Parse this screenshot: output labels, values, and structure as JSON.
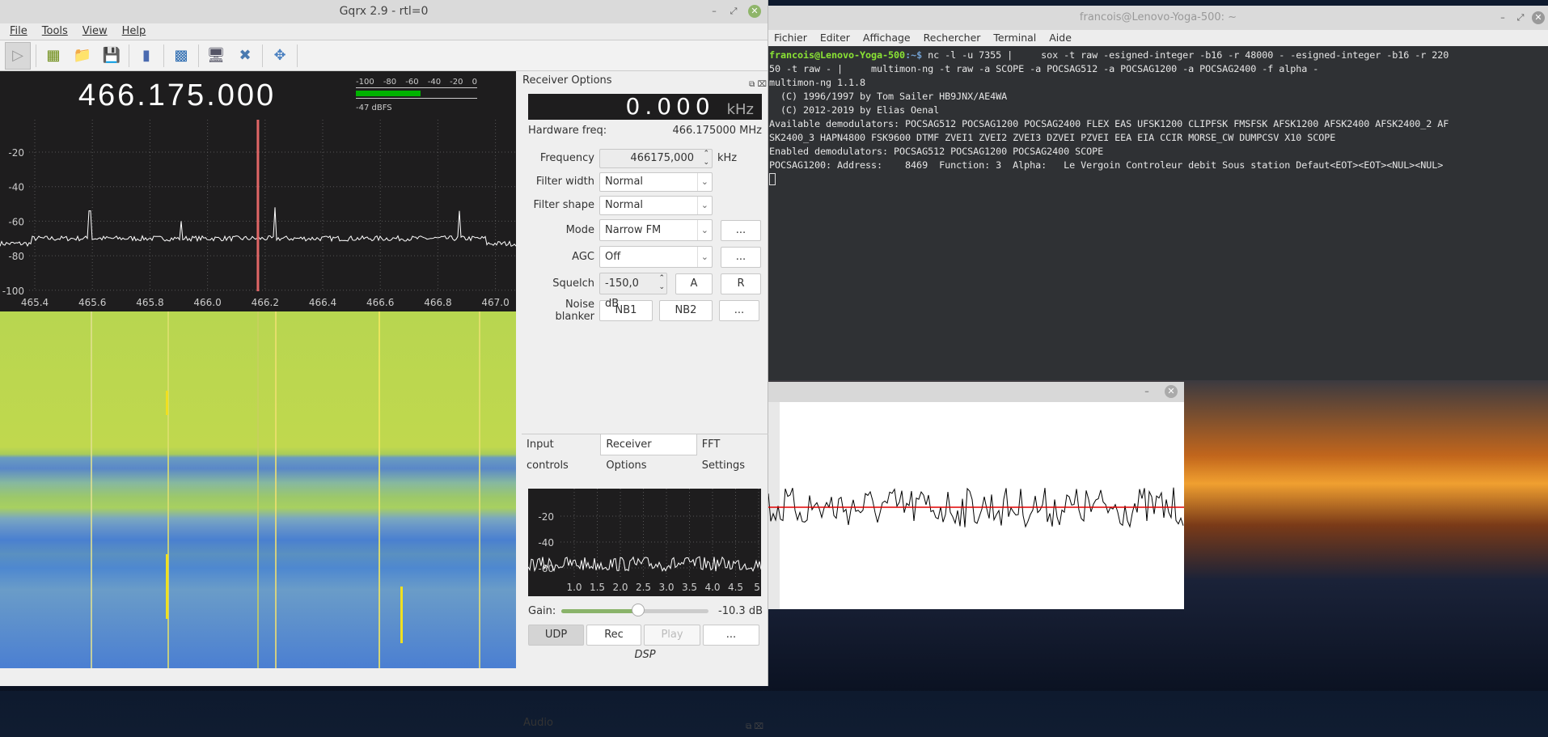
{
  "gqrx": {
    "title": "Gqrx 2.9 - rtl=0",
    "window_buttons": [
      "minimize",
      "maximize",
      "close"
    ],
    "menu": [
      "File",
      "Tools",
      "View",
      "Help"
    ],
    "toolbar": [
      "play-icon",
      "hardware-icon",
      "open-folder-icon",
      "save-icon",
      "remote-control-icon",
      "waveform-icon",
      "network-icon",
      "settings-tools-icon",
      "fullscreen-icon"
    ],
    "frequency": "466.175.000",
    "meter": {
      "ticks": [
        "-100",
        "-80",
        "-60",
        "-40",
        "-20",
        "0"
      ],
      "level_dbfs": -47,
      "label": "-47 dBFS",
      "fill_color": "#00b300"
    },
    "spectrum": {
      "y_ticks": [
        "-20",
        "-40",
        "-60",
        "-80",
        "-100"
      ],
      "x_ticks": [
        "465.4",
        "465.6",
        "465.8",
        "466.0",
        "466.2",
        "466.4",
        "466.6",
        "466.8",
        "467.0"
      ],
      "marker_color": "#e06666"
    },
    "receiver_options": {
      "title": "Receiver Options",
      "offset": "0.000",
      "offset_unit": "kHz",
      "hw_freq_label": "Hardware freq:",
      "hw_freq_value": "466.175000 MHz",
      "frequency_label": "Frequency",
      "frequency_value": "466175,000",
      "frequency_unit": "kHz",
      "filter_width_label": "Filter width",
      "filter_width": "Normal",
      "filter_shape_label": "Filter shape",
      "filter_shape": "Normal",
      "mode_label": "Mode",
      "mode": "Narrow FM",
      "agc_label": "AGC",
      "agc": "Off",
      "squelch_label": "Squelch",
      "squelch": "-150,0 dB",
      "squelch_a": "A",
      "squelch_r": "R",
      "nb_label": "Noise blanker",
      "nb1": "NB1",
      "nb2": "NB2",
      "more": "..."
    },
    "tabs": [
      "Input controls",
      "Receiver Options",
      "FFT Settings"
    ],
    "active_tab": "Receiver Options",
    "audio": {
      "title": "Audio",
      "y_ticks": [
        "-20",
        "-40",
        "-60"
      ],
      "x_ticks": [
        "1.0",
        "1.5",
        "2.0",
        "2.5",
        "3.0",
        "3.5",
        "4.0",
        "4.5",
        "5."
      ],
      "gain_label": "Gain:",
      "gain_value": "-10.3 dB",
      "gain_fraction": 0.52,
      "udp": "UDP",
      "rec": "Rec",
      "play": "Play",
      "more": "...",
      "dsp": "DSP"
    }
  },
  "terminal": {
    "title": "francois@Lenovo-Yoga-500: ~",
    "menu": [
      "Fichier",
      "Editer",
      "Affichage",
      "Rechercher",
      "Terminal",
      "Aide"
    ],
    "prompt_user": "francois@Lenovo-Yoga-500",
    "prompt_dir": ":~$",
    "command": " nc -l -u 7355 |     sox -t raw -esigned-integer -b16 -r 48000 - -esigned-integer -b16 -r 220",
    "lines": [
      "50 -t raw - |     multimon-ng -t raw -a SCOPE -a POCSAG512 -a POCSAG1200 -a POCSAG2400 -f alpha -",
      "multimon-ng 1.1.8",
      "  (C) 1996/1997 by Tom Sailer HB9JNX/AE4WA",
      "  (C) 2012-2019 by Elias Oenal",
      "Available demodulators: POCSAG512 POCSAG1200 POCSAG2400 FLEX EAS UFSK1200 CLIPFSK FMSFSK AFSK1200 AFSK2400 AFSK2400_2 AF",
      "SK2400_3 HAPN4800 FSK9600 DTMF ZVEI1 ZVEI2 ZVEI3 DZVEI PZVEI EEA EIA CCIR MORSE_CW DUMPCSV X10 SCOPE",
      "Enabled demodulators: POCSAG512 POCSAG1200 POCSAG2400 SCOPE",
      "POCSAG1200: Address:    8469  Function: 3  Alpha:   Le Vergoin Controleur debit Sous station Defaut<EOT><EOT><NUL><NUL>"
    ]
  },
  "scope": {
    "trace_color": "#000000",
    "baseline_color": "#e00000"
  }
}
